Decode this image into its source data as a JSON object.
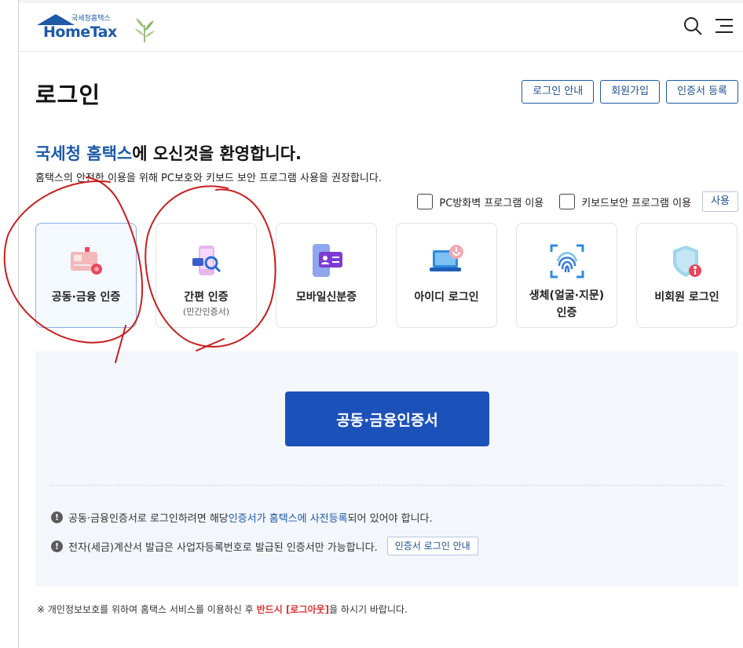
{
  "header": {
    "logo_sub": "국세청홈택스",
    "logo_main": "HomeTax",
    "icons": [
      "search-icon",
      "menu-icon"
    ]
  },
  "page": {
    "title": "로그인",
    "top_buttons": [
      "로그인 안내",
      "회원가입",
      "인증서 등록"
    ]
  },
  "welcome": {
    "highlight": "국세청 홈택스",
    "rest": "에 오신것을 환영합니다.",
    "description": "홈택스의 안전한 이용을 위해 PC보호와 키보드 보안 프로그램 사용을 권장합니다."
  },
  "options": {
    "firewall_label": "PC방화벽 프로그램 이용",
    "keyboard_label": "키보드보안 프로그램 이용",
    "use_label": "사용",
    "firewall_checked": false,
    "keyboard_checked": false
  },
  "login_methods": [
    {
      "label": "공동·금융 인증",
      "sub": "",
      "icon": "certificate-card-icon",
      "active": true
    },
    {
      "label": "간편 인증",
      "sub": "(민간인증서)",
      "icon": "simple-auth-icon",
      "active": false
    },
    {
      "label": "모바일신분증",
      "sub": "",
      "icon": "mobile-id-icon",
      "active": false
    },
    {
      "label": "아이디 로그인",
      "sub": "",
      "icon": "laptop-icon",
      "active": false
    },
    {
      "label": "생체(얼굴·지문)",
      "label2": "인증",
      "sub": "",
      "icon": "fingerprint-icon",
      "active": false
    },
    {
      "label": "비회원 로그인",
      "sub": "",
      "icon": "shield-icon",
      "active": false
    }
  ],
  "panel": {
    "main_button": "공동·금융인증서",
    "note1_a": "공동·금융인증서로 로그인하려면 해당 ",
    "note1_link": "인증서가 홈택스에 사전등록",
    "note1_b": "되어 있어야 합니다.",
    "note2": "전자(세금)계산서 발급은 사업자등록번호로 발급된 인증서만 가능합니다.",
    "note2_button": "인증서 로그인 안내"
  },
  "footer": {
    "text_a": "※ 개인정보보호를 위하여 홈택스 서비스를 이용하신 후 ",
    "text_red": "반드시 [로그아웃]",
    "text_b": "을 하시기 바랍니다."
  },
  "colors": {
    "brand_blue": "#1d5aa8",
    "button_blue": "#1d51ba",
    "panel_bg": "#f3f6fb",
    "annotation_red": "#c81e1e",
    "warning_red": "#dd3333"
  }
}
